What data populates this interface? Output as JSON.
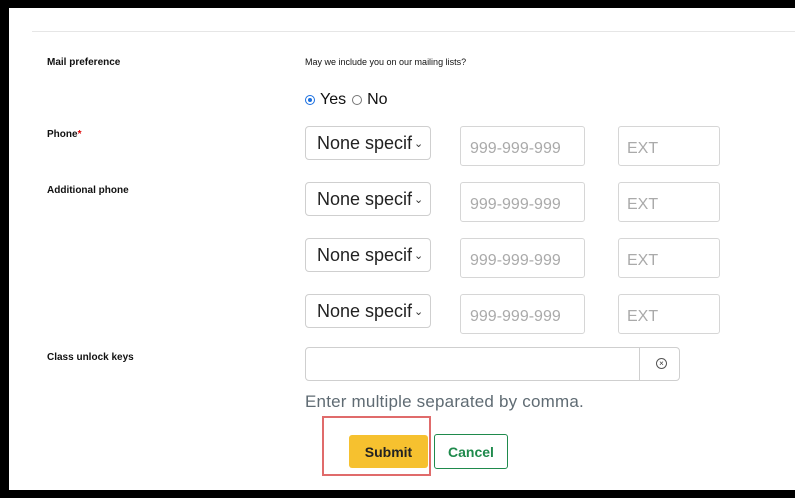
{
  "mail": {
    "label": "Mail preference",
    "question": "May we include you on our mailing lists?",
    "options": [
      "Yes",
      "No"
    ],
    "selected": "Yes"
  },
  "phone": {
    "label": "Phone",
    "required_marker": "*",
    "type_value": "None specif",
    "number_placeholder": "999-999-999",
    "ext_placeholder": "EXT"
  },
  "additional_phone": {
    "label": "Additional phone",
    "rows": [
      {
        "type_value": "None specif",
        "number_placeholder": "999-999-999",
        "ext_placeholder": "EXT"
      },
      {
        "type_value": "None specif",
        "number_placeholder": "999-999-999",
        "ext_placeholder": "EXT"
      },
      {
        "type_value": "None specif",
        "number_placeholder": "999-999-999",
        "ext_placeholder": "EXT"
      }
    ]
  },
  "unlock": {
    "label": "Class unlock keys",
    "value": "",
    "hint": "Enter multiple separated by comma."
  },
  "actions": {
    "submit_label": "Submit",
    "cancel_label": "Cancel"
  },
  "icons": {
    "dropdown": "chevron-down-icon",
    "clear": "clear-circle-icon"
  },
  "colors": {
    "submit_bg": "#f6c12f",
    "cancel_border": "#1f8a4c",
    "radio_accent": "#1a6fe0",
    "required": "#dd0000",
    "highlight": "#e06b6b"
  }
}
